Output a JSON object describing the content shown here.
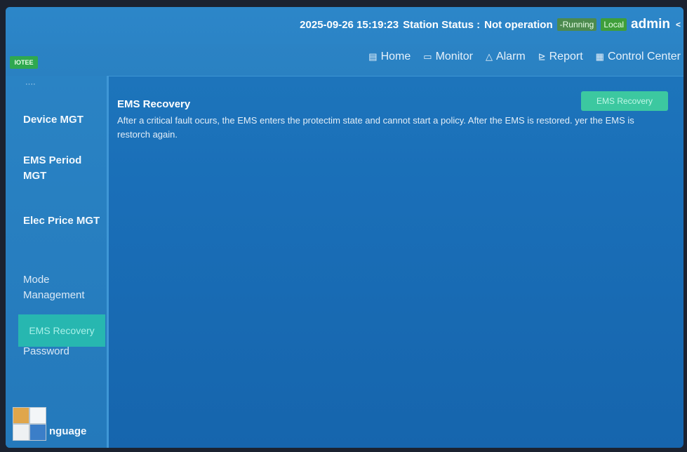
{
  "header": {
    "datetime": "2025-09-26 15:19:23",
    "station_status_label": "Station Status :",
    "station_status_value": "Not operation",
    "running_badge": "-Running",
    "local_badge": "Local",
    "user": "admin",
    "user_caret": "<"
  },
  "logo": {
    "text": "IOTEE"
  },
  "nav": {
    "items": [
      {
        "label": "Home",
        "icon": "home-icon"
      },
      {
        "label": "Monitor",
        "icon": "monitor-icon"
      },
      {
        "label": "Alarm",
        "icon": "alarm-icon"
      },
      {
        "label": "Report",
        "icon": "report-icon"
      },
      {
        "label": "Control Center",
        "icon": "control-center-icon"
      }
    ]
  },
  "sidebar": {
    "partial_top": "····",
    "items": [
      {
        "label": "Device MGT"
      },
      {
        "label": "EMS Period MGT"
      },
      {
        "label": "Elec Price MGT"
      },
      {
        "label": "Mode Management"
      },
      {
        "label": "Second Password"
      },
      {
        "label": "EMS Recovery",
        "active": true
      },
      {
        "label": "nguage"
      }
    ]
  },
  "main": {
    "title": "EMS Recovery",
    "description": "After a critical fault ocurs, the EMS enters the protectim state and cannot start a policy. After the EMS is restored. yer the EMS is restorch again.",
    "button_label": "EMS Recovery"
  },
  "colors": {
    "screen_bg": "#1a6fb8",
    "topbar": "#2b84c6",
    "running_badge": "#4c8a4e",
    "local_badge": "#3f9e3a",
    "active_item": "#27b7b0",
    "recovery_button": "#3cc8a0"
  }
}
